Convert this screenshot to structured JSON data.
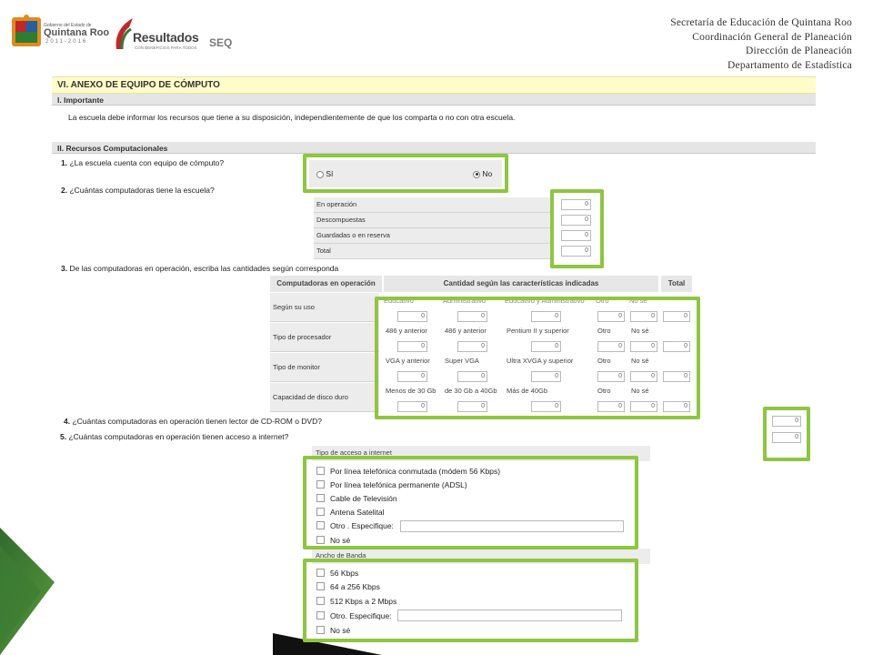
{
  "header": {
    "state_logo": {
      "line1": "Gobierno del Estado de",
      "line2": "Quintana Roo",
      "years": "2011-2016"
    },
    "results_logo": {
      "title": "Resultados",
      "tagline": "CON BENEFICIOS PARA TODOS"
    },
    "seq_logo": "SEQ",
    "institution": [
      "Secretaría de Educación de Quintana Roo",
      "Coordinación General de Planeación",
      "Dirección de Planeación",
      "Departamento de Estadística"
    ]
  },
  "section": {
    "title": "VI. ANEXO DE EQUIPO DE CÓMPUTO",
    "important": {
      "heading": "I. Importante",
      "text": "La escuela debe informar los recursos que tiene a su disposición, independientemente de que los comparta o no con otra escuela."
    },
    "resources_heading": "II. Recursos Computacionales"
  },
  "q1": {
    "num": "1.",
    "text": "¿La escuela cuenta con equipo de cómputo?",
    "options": [
      "Sí",
      "No"
    ],
    "selected": "No"
  },
  "q2": {
    "num": "2.",
    "text": "¿Cuántas computadoras tiene la escuela?",
    "rows": [
      {
        "label": "En operación",
        "value": "0"
      },
      {
        "label": "Descompuestas",
        "value": "0"
      },
      {
        "label": "Guardadas o en reserva",
        "value": "0"
      },
      {
        "label": "Total",
        "value": "0"
      }
    ]
  },
  "q3": {
    "num": "3.",
    "text": "De las computadoras en operación, escriba las cantidades según corresponda",
    "col_header": "Computadoras en operación",
    "group_header": "Cantidad según las características indicadas",
    "total_header": "Total",
    "rows": [
      {
        "label": "Según su uso",
        "options": [
          "Educativo",
          "Administrativo",
          "Educativo y Administrativo",
          "Otro",
          "No sé"
        ],
        "values": [
          "0",
          "0",
          "0",
          "0",
          "0"
        ],
        "total": "0"
      },
      {
        "label": "Tipo de procesador",
        "options": [
          "486 y anterior",
          "486 y anterior",
          "Pentium II y superior",
          "Otro",
          "No sé"
        ],
        "values": [
          "0",
          "0",
          "0",
          "0",
          "0"
        ],
        "total": "0"
      },
      {
        "label": "Tipo de monitor",
        "options": [
          "VGA y anterior",
          "Super VGA",
          "Ultra XVGA y superior",
          "Otro",
          "No sé"
        ],
        "values": [
          "0",
          "0",
          "0",
          "0",
          "0"
        ],
        "total": "0"
      },
      {
        "label": "Capacidad de disco duro",
        "options": [
          "Menos de 30 Gb",
          "de 30 Gb a 40Gb",
          "Más de 40Gb",
          "Otro",
          "No sé"
        ],
        "values": [
          "0",
          "0",
          "0",
          "0",
          "0"
        ],
        "total": "0"
      }
    ]
  },
  "q4": {
    "num": "4.",
    "text": "¿Cuántas computadoras en operación tienen lector de CD-ROM o DVD?",
    "value": "0"
  },
  "q5": {
    "num": "5.",
    "text": "¿Cuántas computadoras en operación tienen acceso a internet?",
    "value": "0",
    "access_header": "Tipo de acceso a internet",
    "access_options": [
      "Por línea telefónica conmutada (módem 56 Kbps)",
      "Por línea telefónica permanente (ADSL)",
      "Cable de Televisión",
      "Antena Satelital",
      "Otro . Especifique:",
      "No sé"
    ],
    "bandwidth_header": "Ancho de Banda",
    "bandwidth_options": [
      "56 Kbps",
      "64 a 256 Kbps",
      "512 Kbps a 2 Mbps",
      "Otro. Especifique:",
      "No sé"
    ]
  },
  "colors": {
    "highlight": "#8dc63f",
    "section_bar": "#fefcc9",
    "subsection_bar": "#e5e5e5",
    "brand_red": "#c0272d",
    "brand_green": "#2e7d32"
  }
}
